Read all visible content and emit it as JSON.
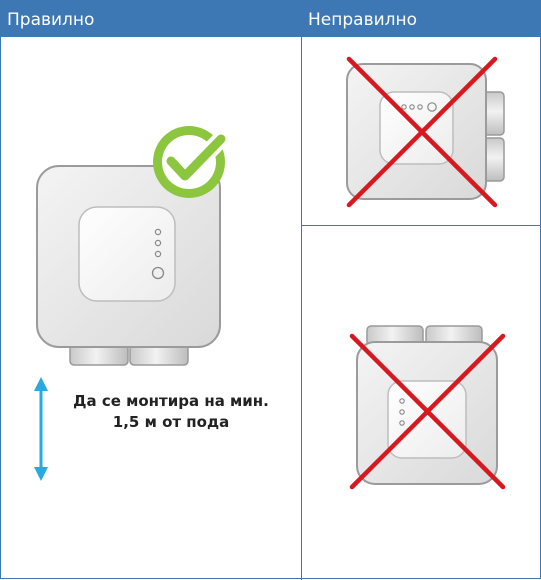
{
  "columns": {
    "correct_label": "Правилно",
    "incorrect_label": "Неправилно"
  },
  "instruction": {
    "line1": "Да се монтира на мин.",
    "line2": "1,5 м от пода"
  },
  "colors": {
    "header_bg": "#3d78b4",
    "check_green": "#8cc63f",
    "cross_red": "#d7191f",
    "arrow_blue": "#27a9e1"
  },
  "icons": [
    "checkmark-icon",
    "cross-icon",
    "vertical-arrow-icon"
  ]
}
